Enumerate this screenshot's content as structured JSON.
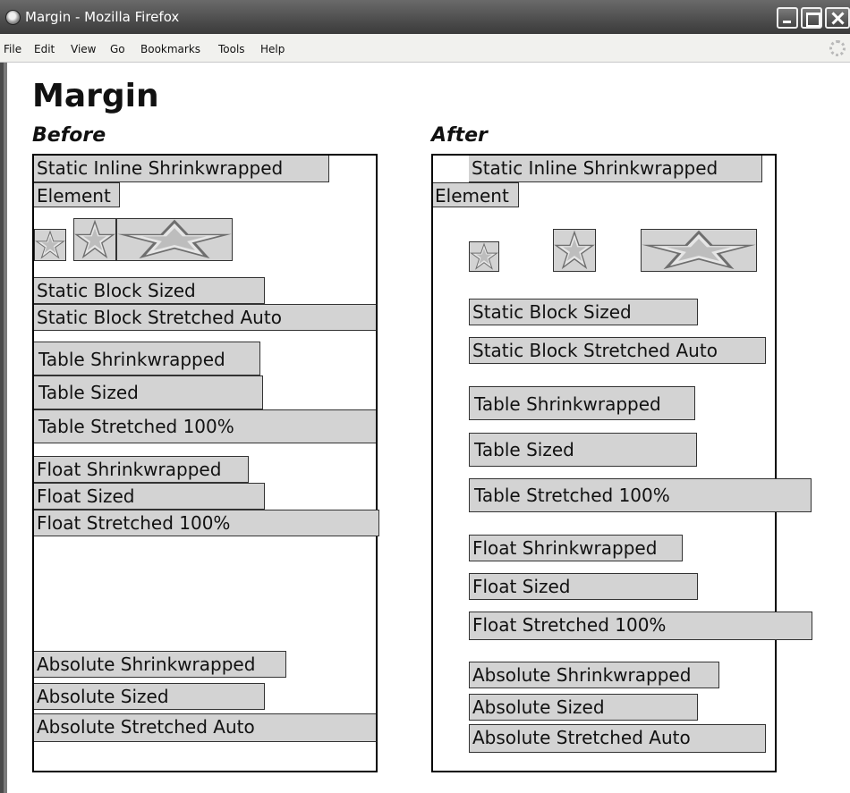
{
  "window": {
    "title": "Margin - Mozilla Firefox",
    "app_icon": "firefox-icon",
    "controls": [
      "minimize-icon",
      "maximize-icon",
      "close-icon"
    ]
  },
  "menu": {
    "items": [
      {
        "label": "File"
      },
      {
        "label": "Edit"
      },
      {
        "label": "View"
      },
      {
        "label": "Go"
      },
      {
        "label": "Bookmarks"
      },
      {
        "label": "Tools"
      },
      {
        "label": "Help"
      }
    ],
    "throbber_icon": "throbber-icon"
  },
  "page": {
    "title": "Margin"
  },
  "before": {
    "heading": "Before",
    "inline_line1": "Static Inline Shrinkwrapped",
    "inline_line2": "Element",
    "images": [
      "star-icon",
      "star-icon",
      "star-icon"
    ],
    "static_block_sized": "Static Block Sized",
    "static_block_stretched": "Static Block Stretched Auto",
    "table_shrinkwrapped": "Table Shrinkwrapped",
    "table_sized": "Table Sized",
    "table_stretched": "Table Stretched 100%",
    "float_shrinkwrapped": "Float Shrinkwrapped",
    "float_sized": "Float Sized",
    "float_stretched": "Float Stretched 100%",
    "absolute_shrinkwrapped": "Absolute Shrinkwrapped",
    "absolute_sized": "Absolute Sized",
    "absolute_stretched": "Absolute Stretched Auto"
  },
  "after": {
    "heading": "After",
    "inline_line1": "Static Inline Shrinkwrapped",
    "inline_line2": "Element",
    "images": [
      "star-icon",
      "star-icon",
      "star-icon"
    ],
    "static_block_sized": "Static Block Sized",
    "static_block_stretched": "Static Block Stretched Auto",
    "table_shrinkwrapped": "Table Shrinkwrapped",
    "table_sized": "Table Sized",
    "table_stretched": "Table Stretched 100%",
    "float_shrinkwrapped": "Float Shrinkwrapped",
    "float_sized": "Float Sized",
    "float_stretched": "Float Stretched 100%",
    "absolute_shrinkwrapped": "Absolute Shrinkwrapped",
    "absolute_sized": "Absolute Sized",
    "absolute_stretched": "Absolute Stretched Auto"
  },
  "colors": {
    "box_fill": "#d3d3d3",
    "titlebar": "#4a4a4a"
  }
}
